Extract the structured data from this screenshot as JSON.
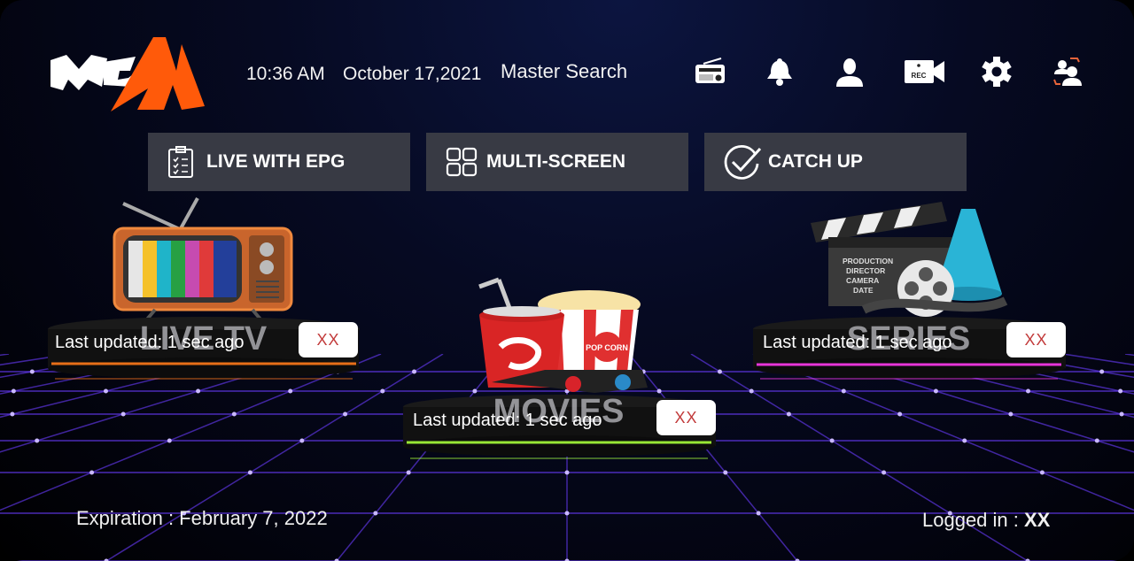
{
  "header": {
    "logo_text": "MAGMA",
    "time": "10:36 AM",
    "date": "October 17,2021",
    "search_label": "Master Search",
    "icons": [
      "radio-icon",
      "bell-icon",
      "user-icon",
      "rec-camera-icon",
      "gear-icon",
      "switch-user-icon"
    ],
    "rec_label": "REC"
  },
  "nav": [
    {
      "label": "LIVE WITH EPG",
      "icon": "clipboard-checklist-icon"
    },
    {
      "label": "MULTI-SCREEN",
      "icon": "grid-icon"
    },
    {
      "label": "CATCH UP",
      "icon": "check-circle-icon"
    }
  ],
  "sections": [
    {
      "title": "LIVE TV",
      "updated": "Last updated: 1 sec ago",
      "badge": "XX",
      "glow": "#ff7a1a"
    },
    {
      "title": "MOVIES",
      "updated": "Last updated: 1 sec ago",
      "badge": "XX",
      "glow": "#a8ff3a"
    },
    {
      "title": "SERIES",
      "updated": "Last updated: 1 sec ago",
      "badge": "XX",
      "glow": "#ff3af0"
    }
  ],
  "clapper_text": [
    "PRODUCTION",
    "DIRECTOR",
    "CAMERA",
    "DATE"
  ],
  "popcorn_text": "POP CORN",
  "footer": {
    "expiration": "Expiration : February 7, 2022",
    "logged_in_label": "Logged in : ",
    "logged_in_user": "XX"
  },
  "colors": {
    "accent": "#ff5a0a",
    "button_bg": "#383a44",
    "grid": "#6a3cff"
  }
}
